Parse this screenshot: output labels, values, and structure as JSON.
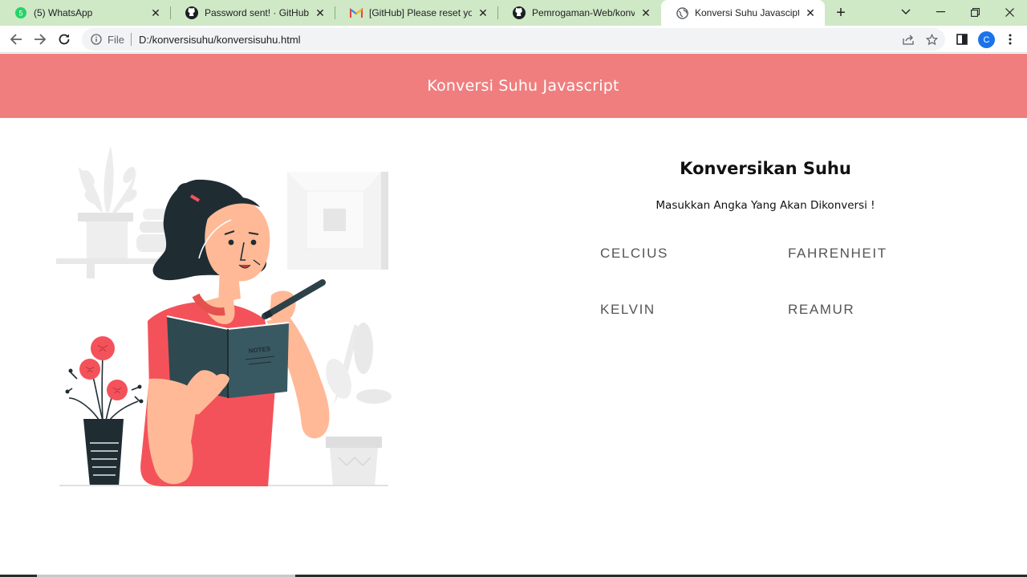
{
  "browser": {
    "tabs": [
      {
        "title": "(5) WhatsApp",
        "icon": "whatsapp-icon",
        "active": false
      },
      {
        "title": "Password sent! · GitHub",
        "icon": "github-icon",
        "active": false
      },
      {
        "title": "[GitHub] Please reset your pa",
        "icon": "gmail-icon",
        "active": false
      },
      {
        "title": "Pemrogaman-Web/konversi",
        "icon": "github-icon",
        "active": false
      },
      {
        "title": "Konversi Suhu Javascipt",
        "icon": "globe-icon",
        "active": true
      }
    ],
    "new_tab_label": "+",
    "address": {
      "scheme_label": "File",
      "url": "D:/konversisuhu/konversisuhu.html"
    },
    "profile_initial": "C"
  },
  "page": {
    "header_title": "Konversi Suhu Javascript",
    "panel_title": "Konversikan Suhu",
    "panel_subtitle": "Masukkan Angka Yang Akan Dikonversi !",
    "units": {
      "celcius": "CELCIUS",
      "fahrenheit": "FAHRENHEIT",
      "kelvin": "KELVIN",
      "reamur": "REAMUR"
    }
  },
  "colors": {
    "tabstrip": "#cfe8c6",
    "header": "#f07e7e",
    "accent_red": "#f4525a",
    "dark_teal": "#1f2d33",
    "skin": "#ffb996"
  }
}
